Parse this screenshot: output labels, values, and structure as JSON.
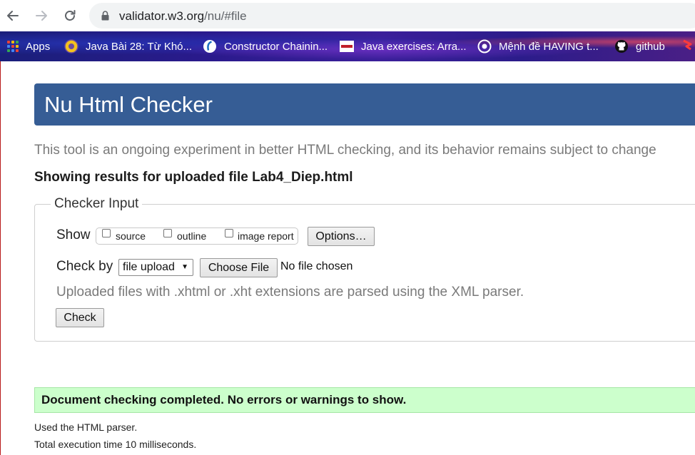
{
  "browser": {
    "url_host": "validator.w3.org",
    "url_path": "/nu/#file",
    "bookmarks": [
      {
        "label": "Apps"
      },
      {
        "label": "Java Bài 28: Từ Khó..."
      },
      {
        "label": "Constructor Chainin..."
      },
      {
        "label": "Java exercises: Arra..."
      },
      {
        "label": "Mệnh đề HAVING t..."
      },
      {
        "label": "github"
      }
    ]
  },
  "page": {
    "title": "Nu Html Checker",
    "tagline": "This tool is an ongoing experiment in better HTML checking, and its behavior remains subject to change",
    "results_heading": "Showing results for uploaded file Lab4_Diep.html",
    "checker_input": {
      "legend": "Checker Input",
      "show_label": "Show",
      "show_options": [
        {
          "label": "source",
          "checked": false
        },
        {
          "label": "outline",
          "checked": false
        },
        {
          "label": "image report",
          "checked": false
        }
      ],
      "options_button": "Options…",
      "check_by_label": "Check by",
      "check_by_selected": "file upload",
      "choose_file_button": "Choose File",
      "no_file_text": "No file chosen",
      "hint": "Uploaded files with .xhtml or .xht extensions are parsed using the XML parser.",
      "check_button": "Check"
    },
    "success_message": "Document checking completed. No errors or warnings to show.",
    "parser_note": "Used the HTML parser.",
    "timing_note": "Total execution time 10 milliseconds."
  },
  "colors": {
    "header_bg": "#365d95",
    "success_bg": "#ccffcc",
    "tagline_gray": "#7a7a7a"
  }
}
